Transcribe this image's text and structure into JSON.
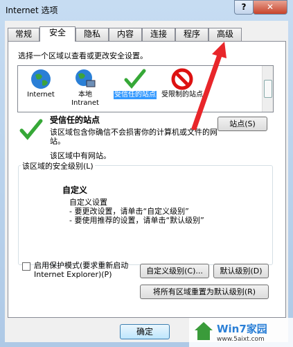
{
  "window": {
    "title": "Internet 选项",
    "help_glyph": "?",
    "close_glyph": "✕"
  },
  "tabs": [
    {
      "label": "常规"
    },
    {
      "label": "安全"
    },
    {
      "label": "隐私"
    },
    {
      "label": "内容"
    },
    {
      "label": "连接"
    },
    {
      "label": "程序"
    },
    {
      "label": "高级"
    }
  ],
  "security": {
    "hint": "选择一个区域以查看或更改安全设置。",
    "zones": [
      {
        "label": "Internet",
        "icon": "globe-icon"
      },
      {
        "label": "本地 Intranet",
        "icon": "intranet-globe-icon"
      },
      {
        "label": "受信任的站点",
        "icon": "check-icon"
      },
      {
        "label": "受限制的站点",
        "icon": "no-entry-icon"
      }
    ],
    "selected_zone_title": "受信任的站点",
    "zone_description": "该区域包含你确信不会损害你的计算机或文件的网站。",
    "zone_no_sites": "该区域中有网站。",
    "sites_button": "站点(S)",
    "group_title": "该区域的安全级别(L)",
    "level_title": "自定义",
    "level_lines": [
      "自定义设置",
      "- 要更改设置，请单击“自定义级别”",
      "- 要使用推荐的设置，请单击“默认级别”"
    ],
    "protected_mode_label": "启用保护模式(要求重新启动 Internet Explorer)(P)",
    "protected_mode_checked": false,
    "custom_level_button": "自定义级别(C)...",
    "default_level_button": "默认级别(D)",
    "reset_all_button": "将所有区域重置为默认级别(R)"
  },
  "footer": {
    "ok_button": "确定"
  },
  "watermark": {
    "text": "Win7家园",
    "url": "www.5aixt.com"
  },
  "annotation": {
    "color": "#e8262a"
  }
}
